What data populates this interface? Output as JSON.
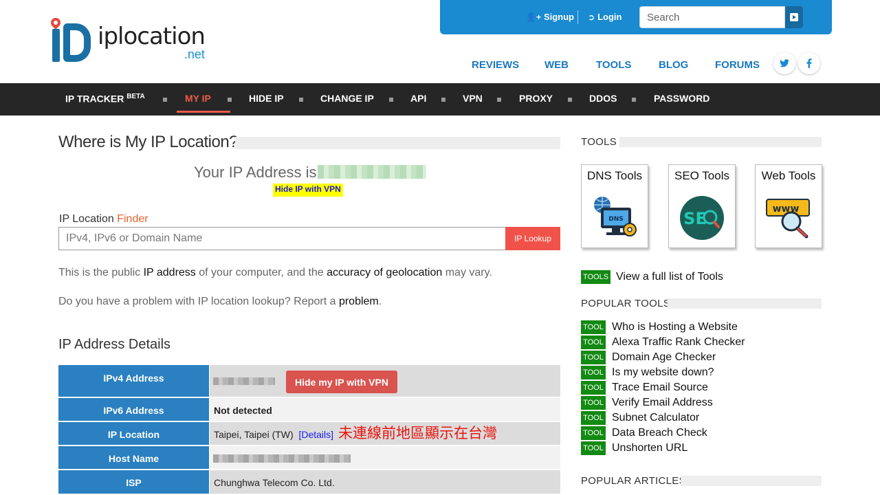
{
  "header": {
    "logo_name": "iplocation",
    "logo_tld": ".net",
    "signup": "Signup",
    "login": "Login",
    "search_placeholder": "Search",
    "subnav": [
      "REVIEWS",
      "WEB",
      "TOOLS",
      "BLOG",
      "FORUMS"
    ],
    "social_icons": [
      "twitter-icon",
      "facebook-icon"
    ]
  },
  "mainnav": {
    "items": [
      {
        "label": "IP TRACKER",
        "sup": "BETA"
      },
      {
        "label": "MY IP",
        "active": true
      },
      {
        "label": "HIDE IP"
      },
      {
        "label": "CHANGE IP"
      },
      {
        "label": "API"
      },
      {
        "label": "VPN"
      },
      {
        "label": "PROXY"
      },
      {
        "label": "DDOS"
      },
      {
        "label": "PASSWORD"
      }
    ]
  },
  "main": {
    "title": "Where is My IP Location?",
    "your_ip_label": "Your IP Address is",
    "hide_ip_link": "Hide IP with VPN",
    "finder_label": "IP Location",
    "finder_accent": "Finder",
    "finder_placeholder": "IPv4, IPv6 or Domain Name",
    "lookup_button": "IP Lookup",
    "para1": {
      "a": "This is the public ",
      "b": "IP address",
      "c": " of your computer, and the ",
      "d": "accuracy of geolocation",
      "e": " may vary."
    },
    "para2": {
      "a": "Do you have a problem with IP location lookup? Report a ",
      "b": "problem",
      "c": "."
    },
    "details_title": "IP Address Details",
    "details": {
      "ipv4_key": "IPv4 Address",
      "hide_my_ip_button": "Hide my IP with VPN",
      "ipv6_key": "IPv6 Address",
      "ipv6_value": "Not detected",
      "location_key": "IP Location",
      "location_value": "Taipei, Taipei (TW)",
      "details_link": "[Details]",
      "host_key": "Host Name",
      "isp_key": "ISP",
      "isp_value": "Chunghwa Telecom Co. Ltd."
    },
    "annotation": "未連線前地區顯示在台灣"
  },
  "sidebar": {
    "tools_heading": "TOOLS",
    "cards": [
      "DNS Tools",
      "SEO Tools",
      "Web Tools"
    ],
    "tools_badge": "TOOLS",
    "full_list": "View a full list of Tools",
    "popular_tools_heading": "POPULAR TOOLS",
    "tool_badge": "TOOL",
    "popular_tools": [
      "Who is Hosting a Website",
      "Alexa Traffic Rank Checker",
      "Domain Age Checker",
      "Is my website down?",
      "Trace Email Source",
      "Verify Email Address",
      "Subnet Calculator",
      "Data Breach Check",
      "Unshorten URL"
    ],
    "popular_articles_heading": "POPULAR ARTICLES"
  },
  "colors": {
    "brand_blue": "#1a8ad1",
    "nav_dark": "#262626",
    "accent_red": "#f05a4a",
    "badge_green": "#138a13",
    "table_key_blue": "#2a80c0"
  }
}
